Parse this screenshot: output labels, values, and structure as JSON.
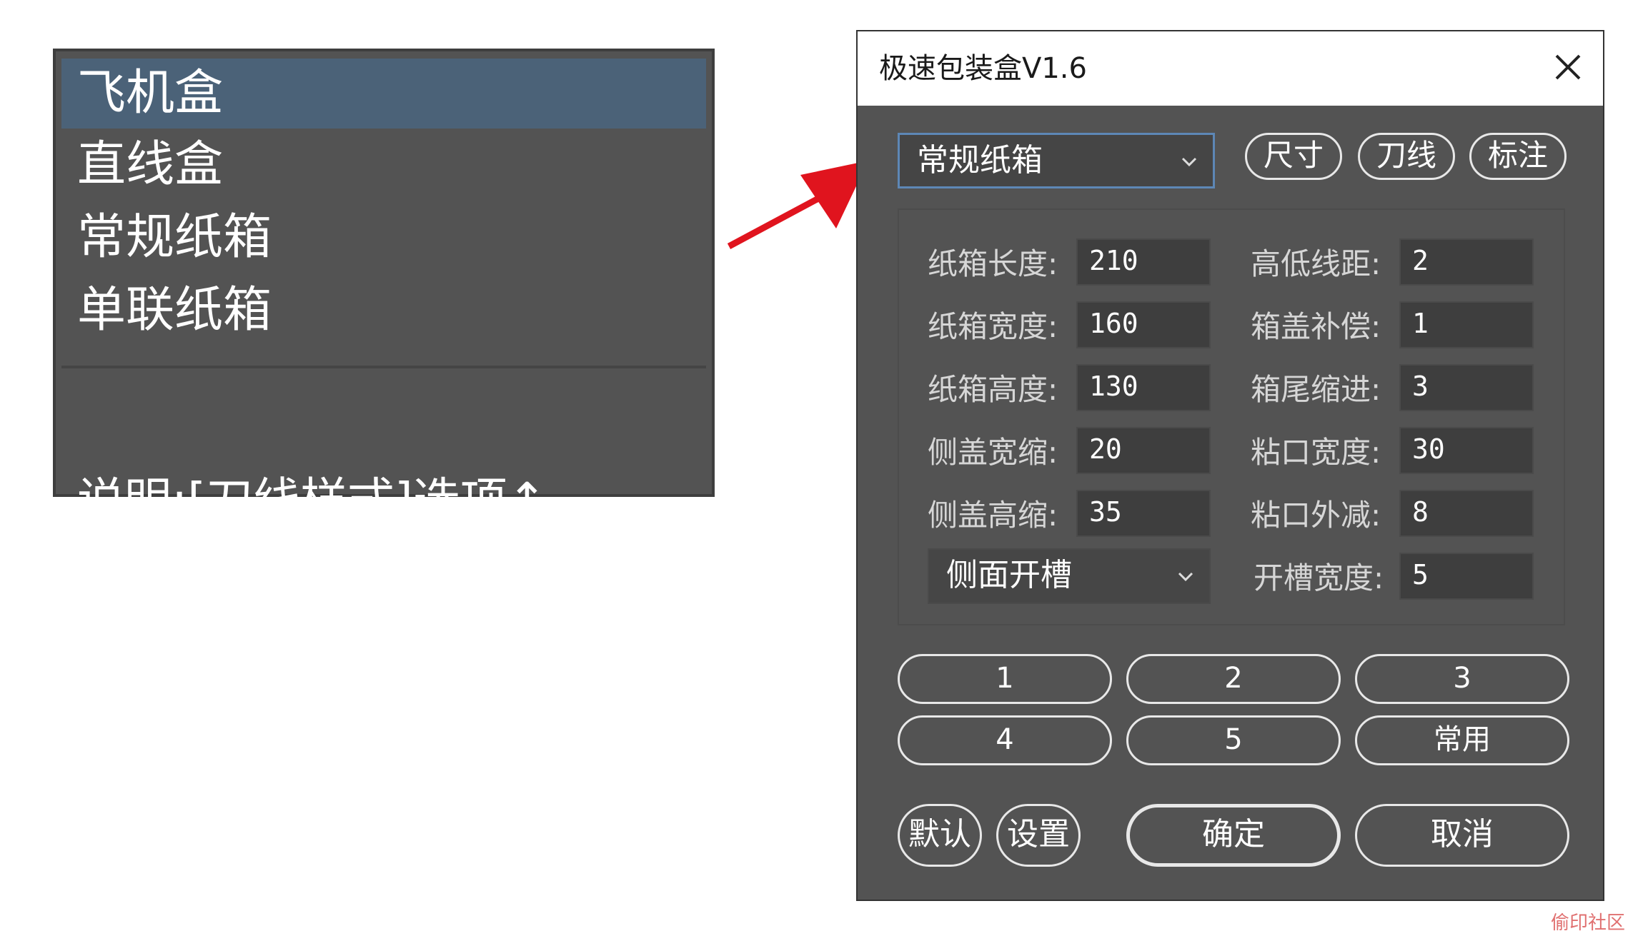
{
  "dropdown_list": {
    "items": [
      "飞机盒",
      "直线盒",
      "常规纸箱",
      "单联纸箱"
    ],
    "selected_index": 0,
    "note": "说明:[刀线样式]选项↑"
  },
  "dialog": {
    "title": "极速包装盒V1.6",
    "box_type_select": "常规纸箱",
    "tools": [
      "尺寸",
      "刀线",
      "标注"
    ],
    "params": [
      {
        "label": "纸箱长度:",
        "value": "210"
      },
      {
        "label": "高低线距:",
        "value": "2"
      },
      {
        "label": "纸箱宽度:",
        "value": "160"
      },
      {
        "label": "箱盖补偿:",
        "value": "1"
      },
      {
        "label": "纸箱高度:",
        "value": "130"
      },
      {
        "label": "箱尾缩进:",
        "value": "3"
      },
      {
        "label": "侧盖宽缩:",
        "value": "20"
      },
      {
        "label": "粘口宽度:",
        "value": "30"
      },
      {
        "label": "侧盖高缩:",
        "value": "35"
      },
      {
        "label": "粘口外减:",
        "value": "8"
      }
    ],
    "slot_select": "侧面开槽",
    "slot_width": {
      "label": "开槽宽度:",
      "value": "5"
    },
    "presets": [
      "1",
      "2",
      "3",
      "4",
      "5",
      "常用"
    ],
    "buttons": {
      "default": "默认",
      "settings": "设置",
      "ok": "确定",
      "cancel": "取消"
    }
  },
  "watermark": "偷印社区"
}
